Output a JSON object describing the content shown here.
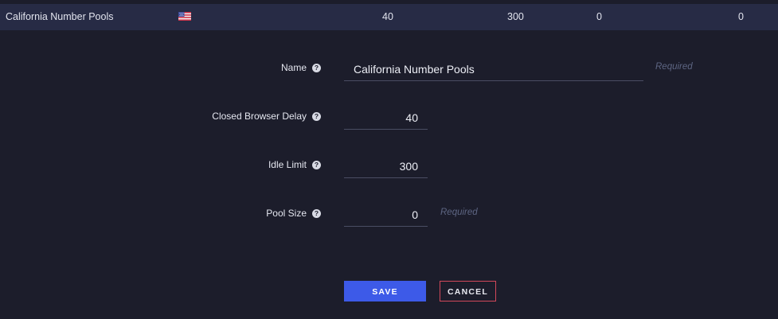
{
  "row": {
    "name": "California Number Pools",
    "flag_icon": "us-flag-icon",
    "closed_browser_delay": "40",
    "idle_limit": "300",
    "pool_size": "0",
    "last_value": "0"
  },
  "form": {
    "name": {
      "label": "Name",
      "value": "California Number Pools",
      "hint": "Required"
    },
    "closed_browser_delay": {
      "label": "Closed Browser Delay",
      "value": "40"
    },
    "idle_limit": {
      "label": "Idle Limit",
      "value": "300"
    },
    "pool_size": {
      "label": "Pool Size",
      "value": "0",
      "hint": "Required"
    },
    "help_icon": "question-circle-icon",
    "help_glyph": "?"
  },
  "buttons": {
    "save": "SAVE",
    "cancel": "CANCEL"
  },
  "colors": {
    "background": "#1c1d2b",
    "row_background": "#272b45",
    "accent": "#3d5ae8",
    "cancel_border": "#d2485a",
    "hint": "#5d6582"
  }
}
